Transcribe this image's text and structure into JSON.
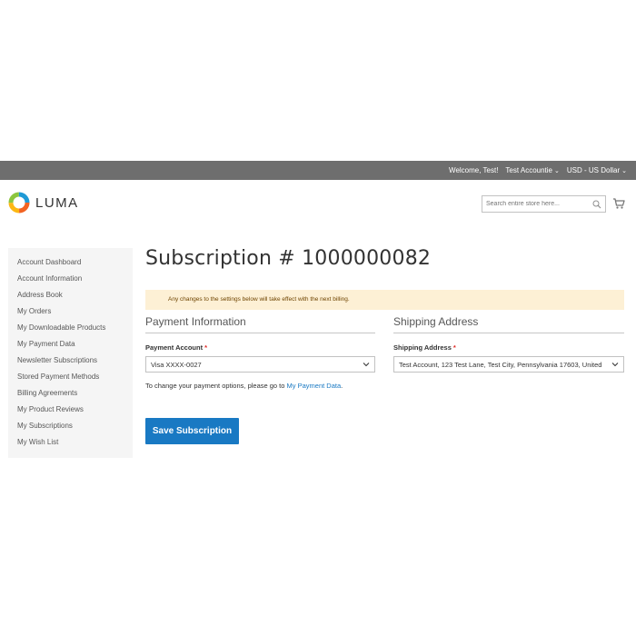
{
  "topbar": {
    "welcome": "Welcome, Test!",
    "account": "Test Accountie",
    "currency": "USD - US Dollar"
  },
  "header": {
    "logo_text": "LUMA",
    "search_placeholder": "Search entire store here...",
    "icons": [
      "luma-logo-icon",
      "search-icon",
      "cart-icon"
    ]
  },
  "sidebar": {
    "items": [
      "Account Dashboard",
      "Account Information",
      "Address Book",
      "My Orders",
      "My Downloadable Products",
      "My Payment Data",
      "Newsletter Subscriptions",
      "Stored Payment Methods",
      "Billing Agreements",
      "My Product Reviews",
      "My Subscriptions",
      "My Wish List"
    ]
  },
  "main": {
    "title": "Subscription # 1000000082",
    "notice": "Any changes to the settings below will take effect with the next billing.",
    "payment": {
      "section_title": "Payment Information",
      "label": "Payment Account",
      "required": "*",
      "selected": "Visa XXXX-0027",
      "help_prefix": "To change your payment options, please go to ",
      "help_link": "My Payment Data",
      "help_suffix": "."
    },
    "shipping": {
      "section_title": "Shipping Address",
      "label": "Shipping Address",
      "required": "*",
      "selected": "Test Account, 123 Test Lane, Test City, Pennsylvania 17603, United"
    },
    "save_label": "Save Subscription"
  },
  "colors": {
    "topbar_bg": "#6e6e6e",
    "primary_button": "#1979c3",
    "link": "#1979c3",
    "notice_bg": "#fdf0d5",
    "required": "#e02b27",
    "sidebar_bg": "#f5f5f5"
  }
}
